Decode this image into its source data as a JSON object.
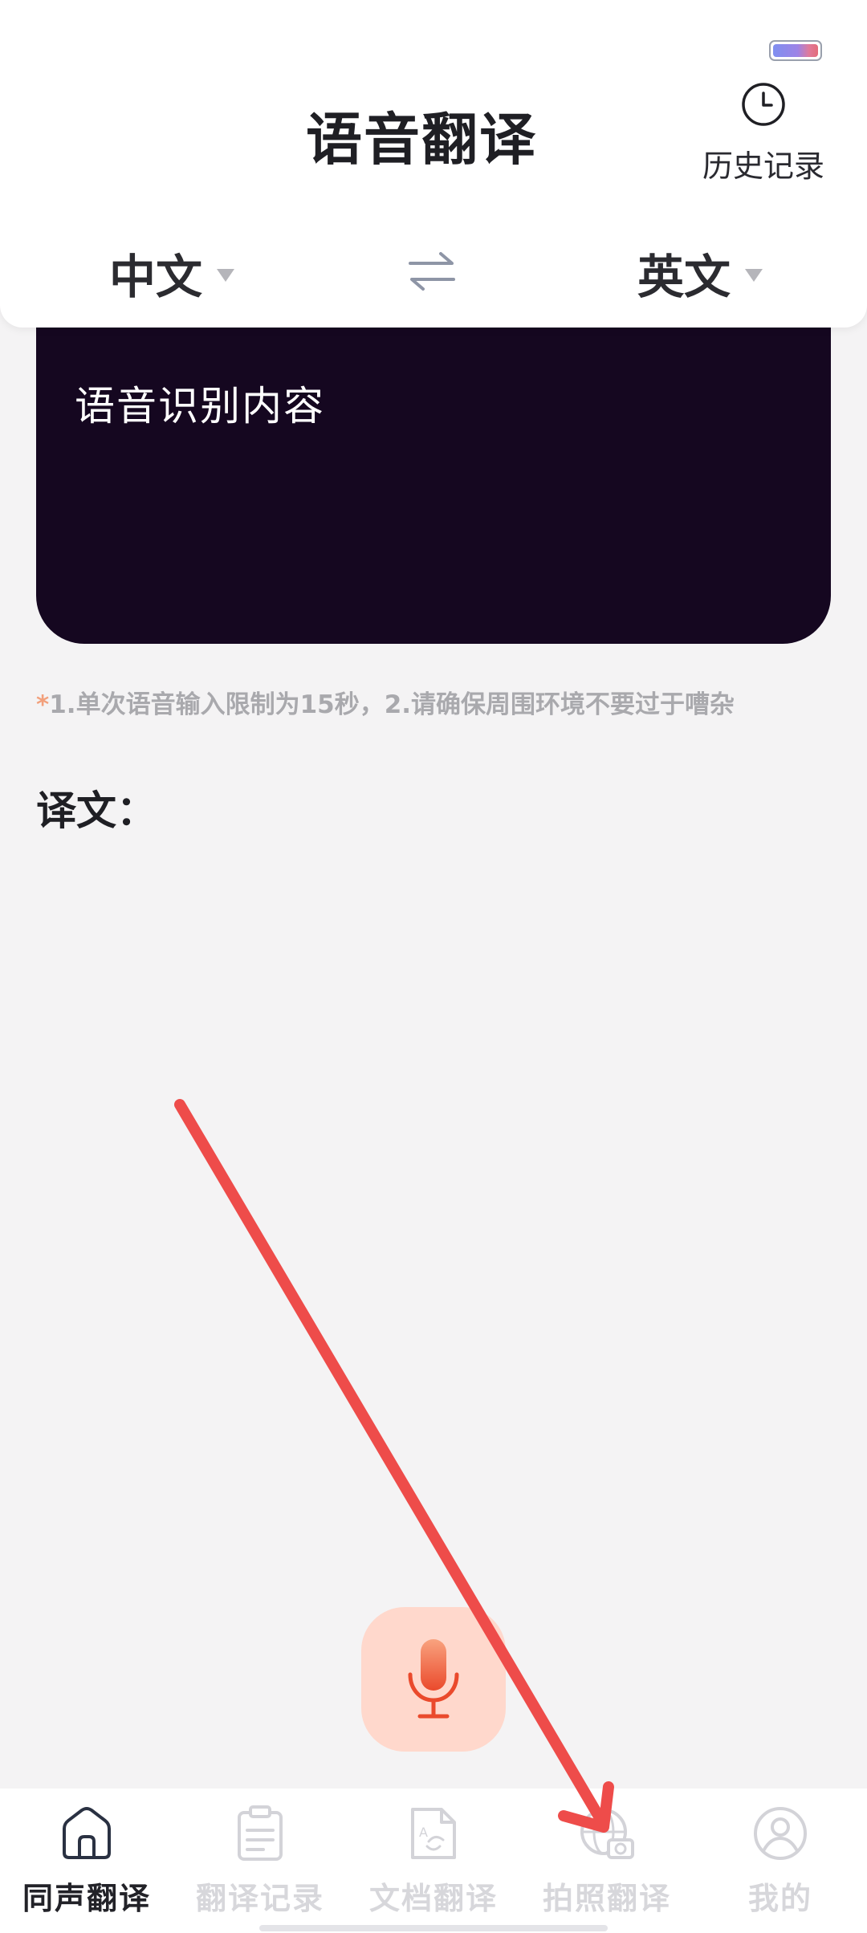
{
  "colors": {
    "accent": "#ef5a3c",
    "card_dark": "#150720",
    "mic_bg": "#ffd8cc",
    "tab_inactive": "#d7d7db",
    "tab_active": "#222228",
    "annotation_arrow": "#ee4c4a"
  },
  "header": {
    "title": "语音翻译",
    "history_label": "历史记录",
    "history_icon": "clock-icon"
  },
  "languages": {
    "source": "中文",
    "target": "英文",
    "swap_icon": "swap-arrows-icon"
  },
  "recognition": {
    "placeholder": "语音识别内容"
  },
  "tip": {
    "star": "*",
    "text": "1.单次语音输入限制为15秒，2.请确保周围环境不要过于嘈杂"
  },
  "result": {
    "label": "译文："
  },
  "mic": {
    "icon": "microphone-icon"
  },
  "tabs": [
    {
      "label": "同声翻译",
      "icon": "home-icon",
      "active": true
    },
    {
      "label": "翻译记录",
      "icon": "clipboard-icon",
      "active": false
    },
    {
      "label": "文档翻译",
      "icon": "document-translate-icon",
      "active": false
    },
    {
      "label": "拍照翻译",
      "icon": "globe-camera-icon",
      "active": false
    },
    {
      "label": "我的",
      "icon": "user-icon",
      "active": false
    }
  ]
}
